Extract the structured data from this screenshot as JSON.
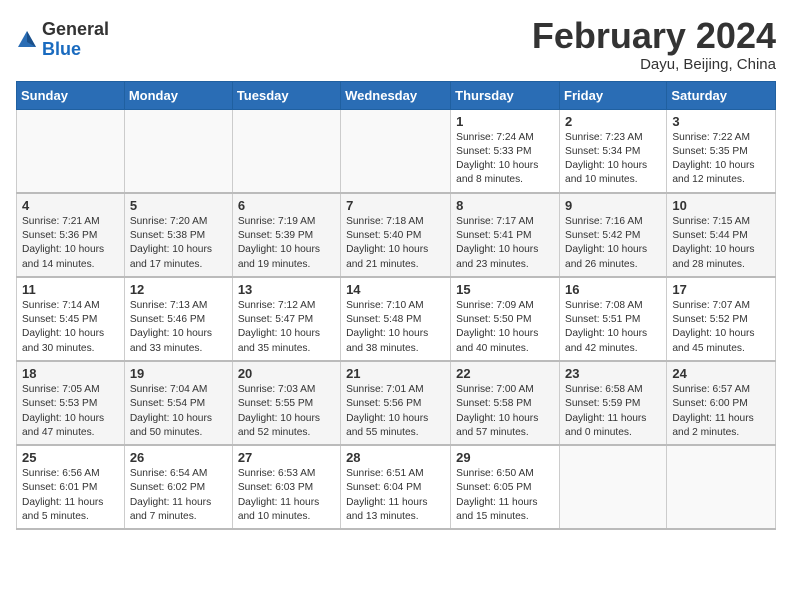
{
  "header": {
    "logo_line1": "General",
    "logo_line2": "Blue",
    "month_title": "February 2024",
    "location": "Dayu, Beijing, China"
  },
  "weekdays": [
    "Sunday",
    "Monday",
    "Tuesday",
    "Wednesday",
    "Thursday",
    "Friday",
    "Saturday"
  ],
  "weeks": [
    [
      {
        "day": "",
        "info": ""
      },
      {
        "day": "",
        "info": ""
      },
      {
        "day": "",
        "info": ""
      },
      {
        "day": "",
        "info": ""
      },
      {
        "day": "1",
        "info": "Sunrise: 7:24 AM\nSunset: 5:33 PM\nDaylight: 10 hours\nand 8 minutes."
      },
      {
        "day": "2",
        "info": "Sunrise: 7:23 AM\nSunset: 5:34 PM\nDaylight: 10 hours\nand 10 minutes."
      },
      {
        "day": "3",
        "info": "Sunrise: 7:22 AM\nSunset: 5:35 PM\nDaylight: 10 hours\nand 12 minutes."
      }
    ],
    [
      {
        "day": "4",
        "info": "Sunrise: 7:21 AM\nSunset: 5:36 PM\nDaylight: 10 hours\nand 14 minutes."
      },
      {
        "day": "5",
        "info": "Sunrise: 7:20 AM\nSunset: 5:38 PM\nDaylight: 10 hours\nand 17 minutes."
      },
      {
        "day": "6",
        "info": "Sunrise: 7:19 AM\nSunset: 5:39 PM\nDaylight: 10 hours\nand 19 minutes."
      },
      {
        "day": "7",
        "info": "Sunrise: 7:18 AM\nSunset: 5:40 PM\nDaylight: 10 hours\nand 21 minutes."
      },
      {
        "day": "8",
        "info": "Sunrise: 7:17 AM\nSunset: 5:41 PM\nDaylight: 10 hours\nand 23 minutes."
      },
      {
        "day": "9",
        "info": "Sunrise: 7:16 AM\nSunset: 5:42 PM\nDaylight: 10 hours\nand 26 minutes."
      },
      {
        "day": "10",
        "info": "Sunrise: 7:15 AM\nSunset: 5:44 PM\nDaylight: 10 hours\nand 28 minutes."
      }
    ],
    [
      {
        "day": "11",
        "info": "Sunrise: 7:14 AM\nSunset: 5:45 PM\nDaylight: 10 hours\nand 30 minutes."
      },
      {
        "day": "12",
        "info": "Sunrise: 7:13 AM\nSunset: 5:46 PM\nDaylight: 10 hours\nand 33 minutes."
      },
      {
        "day": "13",
        "info": "Sunrise: 7:12 AM\nSunset: 5:47 PM\nDaylight: 10 hours\nand 35 minutes."
      },
      {
        "day": "14",
        "info": "Sunrise: 7:10 AM\nSunset: 5:48 PM\nDaylight: 10 hours\nand 38 minutes."
      },
      {
        "day": "15",
        "info": "Sunrise: 7:09 AM\nSunset: 5:50 PM\nDaylight: 10 hours\nand 40 minutes."
      },
      {
        "day": "16",
        "info": "Sunrise: 7:08 AM\nSunset: 5:51 PM\nDaylight: 10 hours\nand 42 minutes."
      },
      {
        "day": "17",
        "info": "Sunrise: 7:07 AM\nSunset: 5:52 PM\nDaylight: 10 hours\nand 45 minutes."
      }
    ],
    [
      {
        "day": "18",
        "info": "Sunrise: 7:05 AM\nSunset: 5:53 PM\nDaylight: 10 hours\nand 47 minutes."
      },
      {
        "day": "19",
        "info": "Sunrise: 7:04 AM\nSunset: 5:54 PM\nDaylight: 10 hours\nand 50 minutes."
      },
      {
        "day": "20",
        "info": "Sunrise: 7:03 AM\nSunset: 5:55 PM\nDaylight: 10 hours\nand 52 minutes."
      },
      {
        "day": "21",
        "info": "Sunrise: 7:01 AM\nSunset: 5:56 PM\nDaylight: 10 hours\nand 55 minutes."
      },
      {
        "day": "22",
        "info": "Sunrise: 7:00 AM\nSunset: 5:58 PM\nDaylight: 10 hours\nand 57 minutes."
      },
      {
        "day": "23",
        "info": "Sunrise: 6:58 AM\nSunset: 5:59 PM\nDaylight: 11 hours\nand 0 minutes."
      },
      {
        "day": "24",
        "info": "Sunrise: 6:57 AM\nSunset: 6:00 PM\nDaylight: 11 hours\nand 2 minutes."
      }
    ],
    [
      {
        "day": "25",
        "info": "Sunrise: 6:56 AM\nSunset: 6:01 PM\nDaylight: 11 hours\nand 5 minutes."
      },
      {
        "day": "26",
        "info": "Sunrise: 6:54 AM\nSunset: 6:02 PM\nDaylight: 11 hours\nand 7 minutes."
      },
      {
        "day": "27",
        "info": "Sunrise: 6:53 AM\nSunset: 6:03 PM\nDaylight: 11 hours\nand 10 minutes."
      },
      {
        "day": "28",
        "info": "Sunrise: 6:51 AM\nSunset: 6:04 PM\nDaylight: 11 hours\nand 13 minutes."
      },
      {
        "day": "29",
        "info": "Sunrise: 6:50 AM\nSunset: 6:05 PM\nDaylight: 11 hours\nand 15 minutes."
      },
      {
        "day": "",
        "info": ""
      },
      {
        "day": "",
        "info": ""
      }
    ]
  ]
}
